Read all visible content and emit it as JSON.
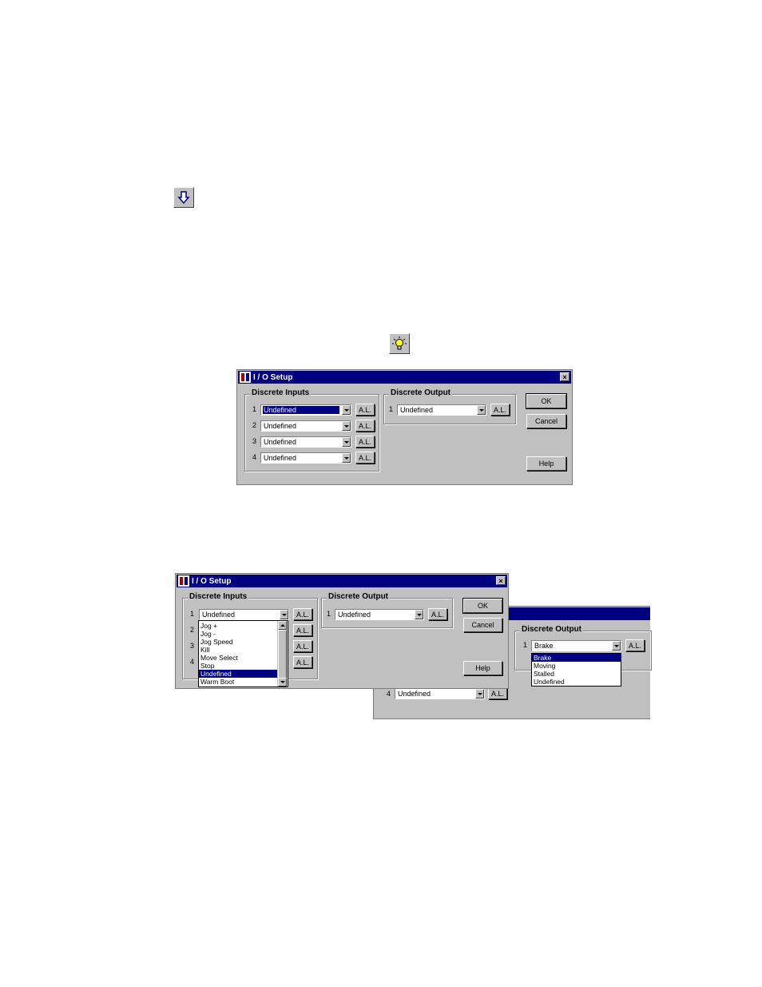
{
  "toolbar_icons": [
    {
      "name": "download-arrow-icon"
    },
    {
      "name": "lightbulb-icon"
    }
  ],
  "dialog_main": {
    "title": "I / O Setup",
    "inputs_group_label": "Discrete Inputs",
    "inputs": [
      {
        "num": "1",
        "value": "Undefined",
        "al_label": "A.L."
      },
      {
        "num": "2",
        "value": "Undefined",
        "al_label": "A.L."
      },
      {
        "num": "3",
        "value": "Undefined",
        "al_label": "A.L."
      },
      {
        "num": "4",
        "value": "Undefined",
        "al_label": "A.L."
      }
    ],
    "output_group_label": "Discrete Output",
    "outputs": [
      {
        "num": "1",
        "value": "Undefined",
        "al_label": "A.L."
      }
    ],
    "ok_label": "OK",
    "cancel_label": "Cancel",
    "help_label": "Help",
    "close_label": "×"
  },
  "dialog_input_dropdown": {
    "title": "I / O Setup",
    "inputs_group_label": "Discrete Inputs",
    "input_row_nums": [
      "1",
      "2",
      "3",
      "4"
    ],
    "input1_value": "Undefined",
    "al_label": "A.L.",
    "output_group_label": "Discrete Output",
    "output_num": "1",
    "output_value": "Undefined",
    "dropdown_options": [
      "Jog +",
      "Jog -",
      "Jog Speed",
      "Kill",
      "Move Select",
      "Stop",
      "Undefined",
      "Warm Boot"
    ],
    "dropdown_selected": "Undefined",
    "ok_label": "OK",
    "cancel_label": "Cancel",
    "help_label": "Help",
    "close_label": "×"
  },
  "dialog_output_dropdown": {
    "output_group_label": "Discrete Output",
    "output_num": "1",
    "output_value": "Brake",
    "al_label": "A.L.",
    "dropdown_options": [
      "Brake",
      "Moving",
      "Stalled",
      "Undefined"
    ],
    "dropdown_selected": "Brake",
    "input4_num": "4",
    "input4_value": "Undefined"
  }
}
